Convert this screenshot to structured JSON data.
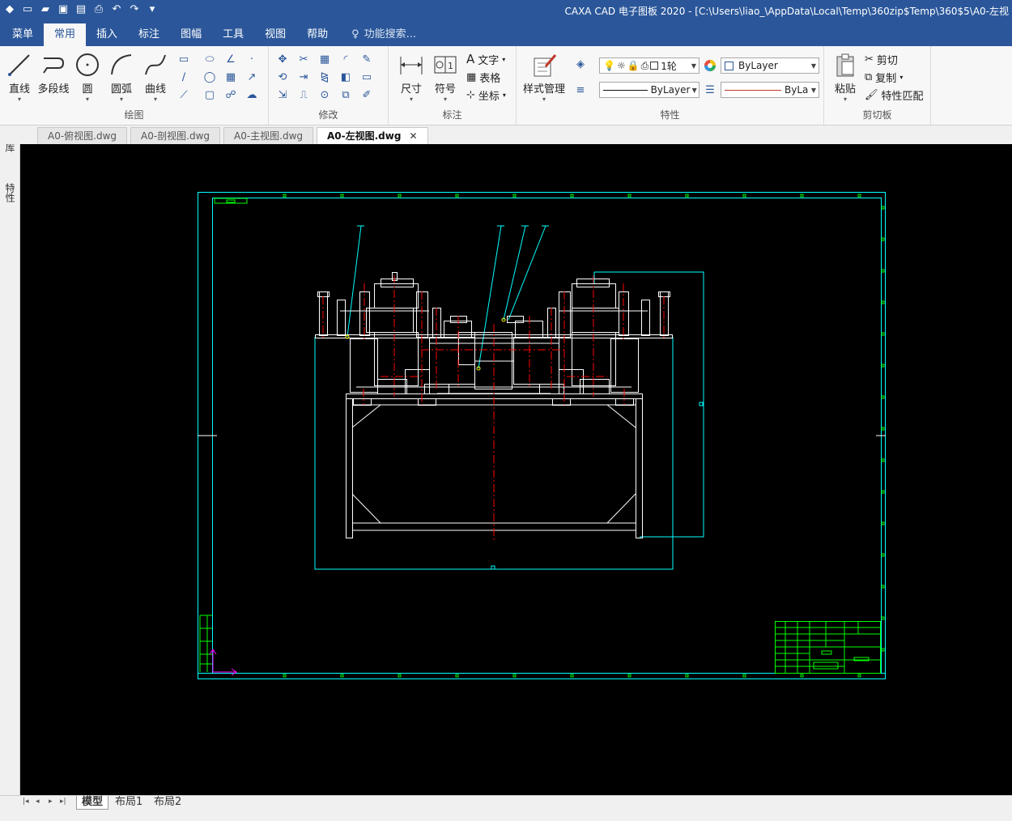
{
  "window": {
    "title": "CAXA CAD 电子图板 2020 - [C:\\Users\\liao_\\AppData\\Local\\Temp\\360zip$Temp\\360$5\\A0-左视"
  },
  "ribbon_tabs": [
    "菜单",
    "常用",
    "插入",
    "标注",
    "图幅",
    "工具",
    "视图",
    "帮助"
  ],
  "search": {
    "placeholder": "功能搜索..."
  },
  "groups": {
    "draw": {
      "label": "绘图",
      "line": "直线",
      "polyline": "多段线",
      "circle": "圆",
      "arc": "圆弧",
      "curve": "曲线"
    },
    "modify": {
      "label": "修改"
    },
    "annotation": {
      "label": "标注",
      "dimension": "尺寸",
      "symbol": "符号",
      "text": "文字",
      "table": "表格",
      "coordinate": "坐标"
    },
    "properties": {
      "label": "特性",
      "style_manager": "样式管理",
      "layer_combo": "1轮",
      "color_combo": "ByLayer",
      "linetype_combo": "ByLayer",
      "lineweight_combo": "ByLayer"
    },
    "clipboard": {
      "label": "剪切板",
      "paste": "粘贴",
      "cut": "剪切",
      "copy": "复制",
      "match": "特性匹配"
    }
  },
  "doc_tabs": [
    "A0-俯视图.dwg",
    "A0-剖视图.dwg",
    "A0-主视图.dwg",
    "A0-左视图.dwg"
  ],
  "active_doc_tab": "A0-左视图.dwg",
  "side_panels": [
    "图库",
    "特性"
  ],
  "layout_tabs": [
    "模型",
    "布局1",
    "布局2"
  ],
  "colors": {
    "title_bar": "#2b579a",
    "canvas": "#000000",
    "frame": "#00ffff",
    "geometry": "#ffffff",
    "centerline": "#ff0000",
    "titleblock": "#00ff00"
  }
}
